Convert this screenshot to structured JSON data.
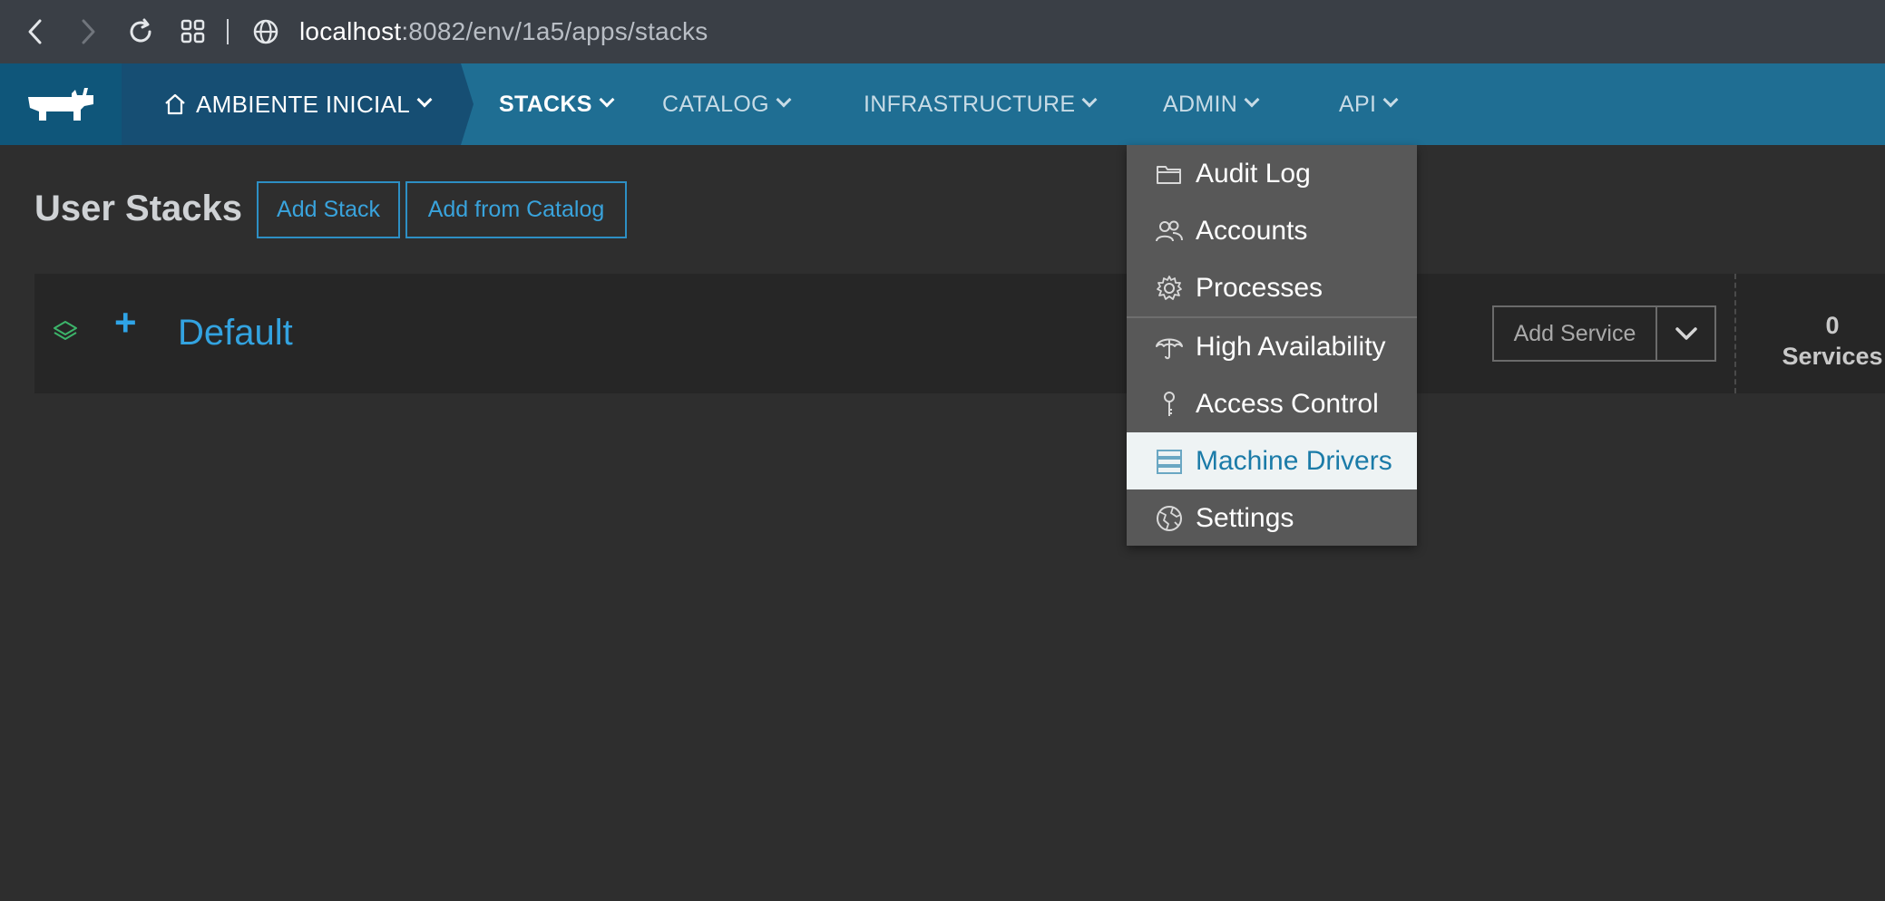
{
  "browser": {
    "url_host": "localhost",
    "url_rest": ":8082/env/1a5/apps/stacks"
  },
  "header": {
    "environment": "AMBIENTE INICIAL",
    "nav": {
      "stacks": "STACKS",
      "catalog": "CATALOG",
      "infrastructure": "INFRASTRUCTURE",
      "admin": "ADMIN",
      "api": "API"
    }
  },
  "page": {
    "title": "User Stacks",
    "add_stack": "Add Stack",
    "add_from_catalog": "Add from Catalog"
  },
  "stack": {
    "name": "Default",
    "add_service": "Add Service",
    "service_count": "0",
    "service_label": "Services"
  },
  "admin_menu": {
    "items": [
      {
        "label": "Audit Log",
        "icon": "folder-icon"
      },
      {
        "label": "Accounts",
        "icon": "users-icon"
      },
      {
        "label": "Processes",
        "icon": "gear-icon"
      },
      {
        "label": "High Availability",
        "icon": "umbrella-icon"
      },
      {
        "label": "Access Control",
        "icon": "key-icon"
      },
      {
        "label": "Machine Drivers",
        "icon": "server-icon"
      },
      {
        "label": "Settings",
        "icon": "globe-settings-icon"
      }
    ],
    "selected": "Machine Drivers"
  },
  "colors": {
    "header_bg": "#1f6e93",
    "env_bg": "#164e73",
    "link_blue": "#33a3e0",
    "menu_bg": "#585858",
    "menu_selected_bg": "#eef3f4"
  }
}
